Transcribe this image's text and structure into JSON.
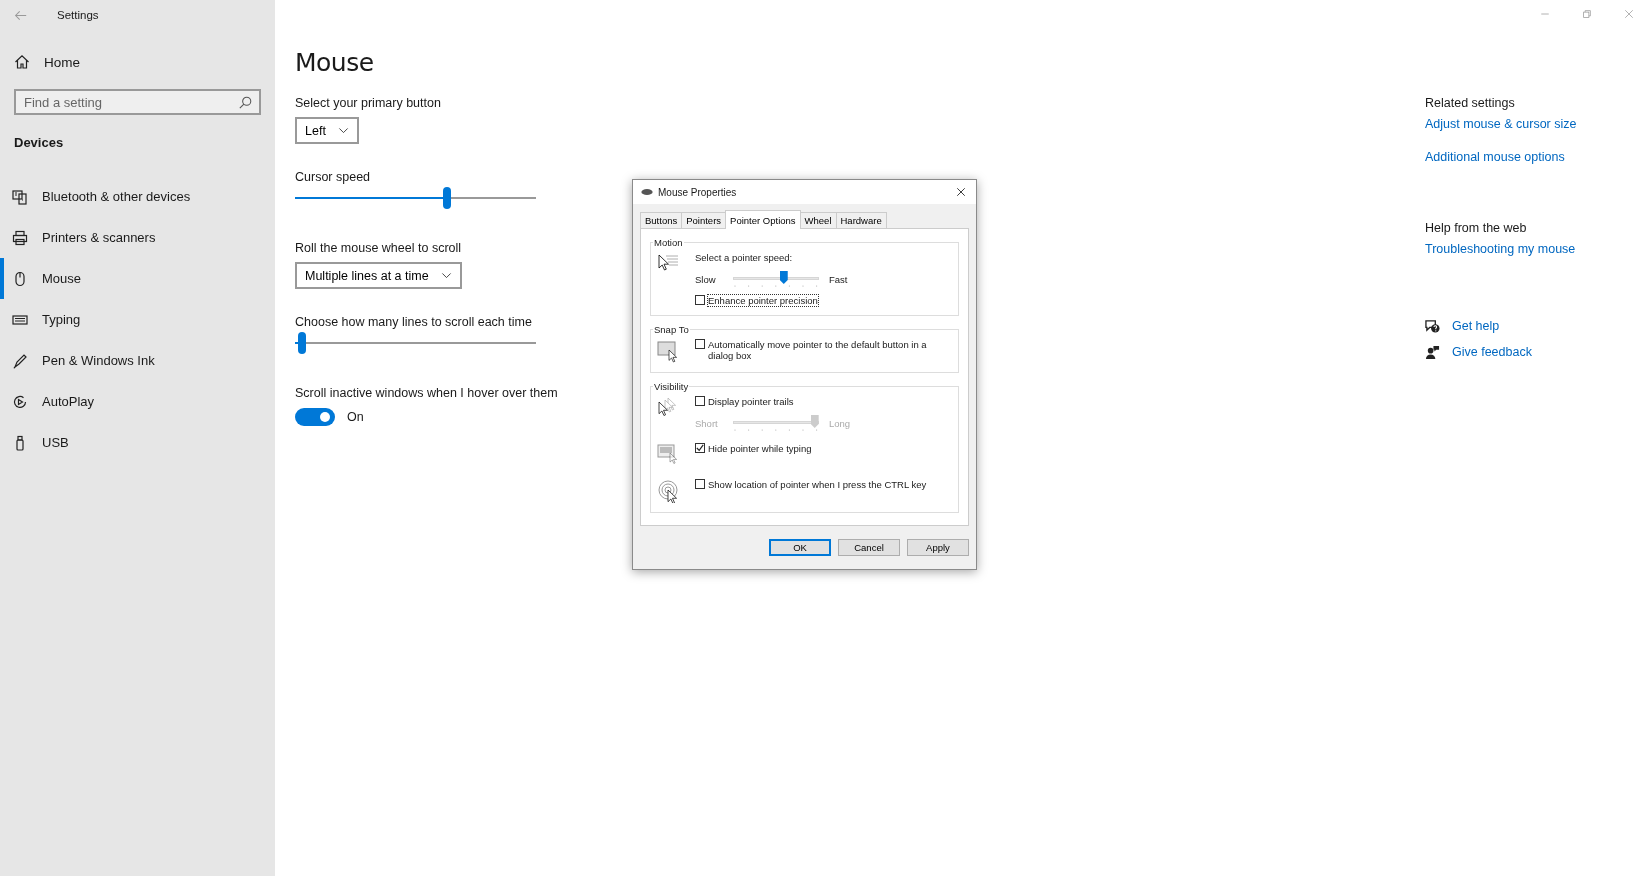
{
  "window": {
    "title": "Settings"
  },
  "sidebar": {
    "home": "Home",
    "search": {
      "placeholder": "Find a setting"
    },
    "section": "Devices",
    "items": [
      {
        "label": "Bluetooth & other devices",
        "kind": "devices",
        "selected": false
      },
      {
        "label": "Printers & scanners",
        "kind": "printer",
        "selected": false
      },
      {
        "label": "Mouse",
        "kind": "mouse",
        "selected": true
      },
      {
        "label": "Typing",
        "kind": "keyboard",
        "selected": false
      },
      {
        "label": "Pen & Windows Ink",
        "kind": "pen",
        "selected": false
      },
      {
        "label": "AutoPlay",
        "kind": "autoplay",
        "selected": false
      },
      {
        "label": "USB",
        "kind": "usb",
        "selected": false
      }
    ]
  },
  "main": {
    "title": "Mouse",
    "settings": [
      {
        "kind": "dropdown",
        "label": "Select your primary button",
        "value": "Left"
      },
      {
        "kind": "slider",
        "label": "Cursor speed",
        "level": 0.63
      },
      {
        "kind": "dropdown",
        "label": "Roll the mouse wheel to scroll",
        "value": "Multiple lines at a time"
      },
      {
        "kind": "slider",
        "label": "Choose how many lines to scroll each time",
        "level": 0.03
      },
      {
        "kind": "toggle",
        "label": "Scroll inactive windows when I hover over them",
        "on": true,
        "state_text": "On"
      }
    ]
  },
  "related": {
    "title": "Related settings",
    "links": [
      "Adjust mouse & cursor size",
      "Additional mouse options"
    ],
    "help_title": "Help from the web",
    "help_links": [
      "Troubleshooting my mouse"
    ],
    "actions": [
      {
        "label": "Get help",
        "kind": "help"
      },
      {
        "label": "Give feedback",
        "kind": "feedback"
      }
    ]
  },
  "dialog": {
    "title": "Mouse Properties",
    "tabs": [
      {
        "label": "Buttons",
        "selected": false
      },
      {
        "label": "Pointers",
        "selected": false
      },
      {
        "label": "Pointer Options",
        "selected": true
      },
      {
        "label": "Wheel",
        "selected": false
      },
      {
        "label": "Hardware",
        "selected": false
      }
    ],
    "groups": [
      {
        "title": "Motion",
        "sections": [
          {
            "kind": "speed",
            "items": [
              {
                "kind": "text",
                "label": "Select a pointer speed:"
              },
              {
                "kind": "slider",
                "left": "Slow",
                "right": "Fast",
                "level": 0.59,
                "disabled": false
              },
              {
                "kind": "checkbox",
                "label": "Enhance pointer precision",
                "checked": false,
                "focused": true
              }
            ]
          }
        ]
      },
      {
        "title": "Snap To",
        "sections": [
          {
            "kind": "snap",
            "items": [
              {
                "kind": "checkbox",
                "label": "Automatically move pointer to the default button in a dialog box",
                "checked": false,
                "focused": false
              }
            ]
          }
        ]
      },
      {
        "title": "Visibility",
        "sections": [
          {
            "kind": "trails",
            "items": [
              {
                "kind": "checkbox",
                "label": "Display pointer trails",
                "checked": false,
                "focused": false
              },
              {
                "kind": "slider",
                "left": "Short",
                "right": "Long",
                "level": 0.95,
                "disabled": true
              }
            ]
          },
          {
            "kind": "hide",
            "items": [
              {
                "kind": "checkbox",
                "label": "Hide pointer while typing",
                "checked": true,
                "focused": false
              }
            ]
          },
          {
            "kind": "locate",
            "items": [
              {
                "kind": "checkbox",
                "label": "Show location of pointer when I press the CTRL key",
                "checked": false,
                "focused": false
              }
            ]
          }
        ]
      }
    ],
    "buttons": [
      {
        "label": "OK",
        "default": true
      },
      {
        "label": "Cancel",
        "default": false
      },
      {
        "label": "Apply",
        "default": false
      }
    ]
  }
}
